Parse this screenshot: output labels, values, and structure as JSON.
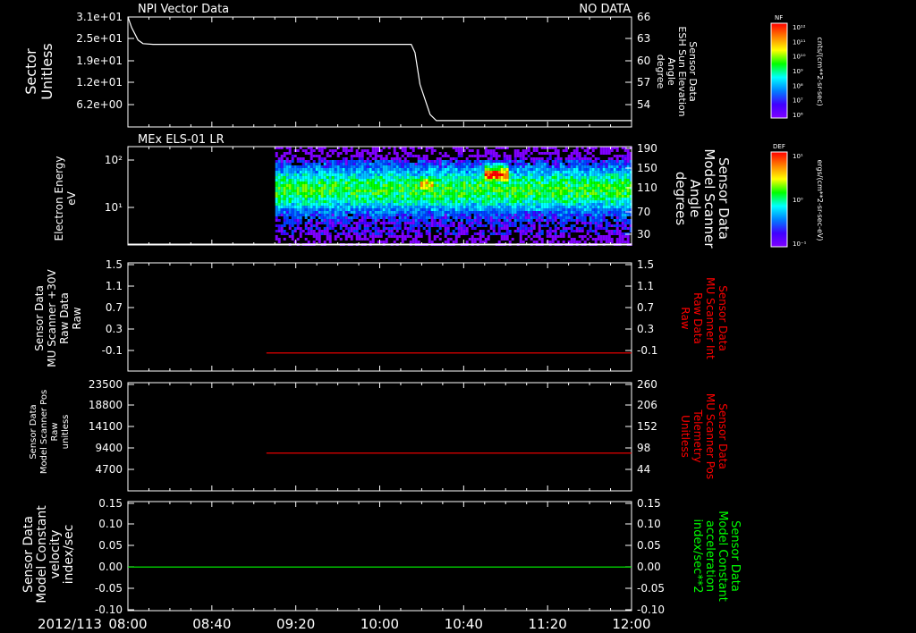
{
  "time_axis": {
    "date_label": "2012/113",
    "ticks": [
      "08:00",
      "08:40",
      "09:20",
      "10:00",
      "10:40",
      "11:20",
      "12:00"
    ],
    "range_hours": [
      8.0,
      12.0
    ]
  },
  "colorbars": [
    {
      "title": "NF",
      "units": "cnts/(cm**2-sr-sec)",
      "tick_labels": [
        "10¹²",
        "10¹¹",
        "10¹⁰",
        "10⁹",
        "10⁸",
        "10⁷",
        "10⁶"
      ],
      "palette": [
        "#ff0000",
        "#ff8000",
        "#ffff00",
        "#00ff00",
        "#00ffff",
        "#0080ff",
        "#4000ff",
        "#8000ff"
      ]
    },
    {
      "title": "DEF",
      "units": "ergs/(cm**2-sr-sec-eV)",
      "tick_labels": [
        "10¹",
        "10⁰",
        "10⁻¹"
      ],
      "palette": [
        "#ff0000",
        "#ff8000",
        "#ffff00",
        "#00ff00",
        "#00ffff",
        "#0080ff",
        "#4000ff",
        "#8000ff"
      ]
    }
  ],
  "panels": [
    {
      "id": "sector",
      "title_left": "NPI Vector Data",
      "title_right": "NO DATA",
      "ylabel_left": [
        "Sector",
        "Unitless"
      ],
      "ylabel_right": [
        "Sensor Data",
        "ESH Sun Elevation",
        "Angle",
        "degree"
      ],
      "ylabel_right_color": "#ffffff",
      "yticks_left": [
        "3.1e+01",
        "2.5e+01",
        "1.9e+01",
        "1.2e+01",
        "6.2e+00"
      ],
      "yticks_right": [
        "66",
        "63",
        "60",
        "57",
        "54"
      ],
      "line_color": "#ffffff"
    },
    {
      "id": "els",
      "title_left": "MEx ELS-01 LR",
      "ylabel_left": [
        "Electron Energy",
        "eV"
      ],
      "ylabel_right": [
        "Sensor Data",
        "Model Scanner",
        "Angle",
        "degrees"
      ],
      "ylabel_right_color": "#ffffff",
      "yticks_left_major": [
        "10²",
        "10¹"
      ],
      "yticks_right": [
        "190",
        "150",
        "110",
        "70",
        "30"
      ]
    },
    {
      "id": "mu_raw",
      "ylabel_left": [
        "Sensor Data",
        "MU Scanner +30V",
        "Raw Data",
        "Raw"
      ],
      "ylabel_right": [
        "Sensor Data",
        "MU Scanner Int",
        "Raw Data",
        "Raw"
      ],
      "ylabel_right_color": "#ff0000",
      "yticks_left": [
        "1.5",
        "1.1",
        "0.7",
        "0.3",
        "-0.1"
      ],
      "yticks_right": [
        "1.5",
        "1.1",
        "0.7",
        "0.3",
        "-0.1"
      ],
      "line_color": "#ff0000"
    },
    {
      "id": "mu_pos",
      "ylabel_left": [
        "Sensor Data",
        "Model Scanner Pos",
        "Raw",
        "unitless"
      ],
      "ylabel_right": [
        "Sensor Data",
        "MU Scanner Pos",
        "Telemetry",
        "Unitless"
      ],
      "ylabel_right_color": "#ff0000",
      "yticks_left": [
        "23500",
        "18800",
        "14100",
        "9400",
        "4700"
      ],
      "yticks_right": [
        "260",
        "206",
        "152",
        "98",
        "44"
      ],
      "line_color": "#ff0000"
    },
    {
      "id": "model_const",
      "ylabel_left": [
        "Sensor Data",
        "Model Constant",
        "velocity",
        "index/sec"
      ],
      "ylabel_right": [
        "Sensor Data",
        "Model Constant",
        "acceleration",
        "index/sec**2"
      ],
      "ylabel_right_color": "#00ff00",
      "yticks_left": [
        "0.15",
        "0.10",
        "0.05",
        "0.00",
        "-0.05",
        "-0.10"
      ],
      "yticks_right": [
        "0.15",
        "0.10",
        "0.05",
        "0.00",
        "-0.05",
        "-0.10"
      ],
      "line_color": "#00ff00"
    }
  ],
  "chart_data": [
    {
      "type": "line",
      "panel": "sector",
      "xlabel": "",
      "ylabel": "Sector Unitless",
      "x_unit": "hours UT",
      "ylim": [
        0,
        31
      ],
      "x": [
        8.0,
        8.03,
        8.08,
        8.12,
        8.2,
        9.0,
        9.8,
        10.0,
        10.25,
        10.28,
        10.32,
        10.4,
        10.45,
        11.0,
        12.0
      ],
      "values": [
        31,
        28,
        24.5,
        23.5,
        23.3,
        23.3,
        23.3,
        23.3,
        23.3,
        21,
        12,
        3.5,
        1.8,
        1.8,
        1.8
      ]
    },
    {
      "type": "heatmap",
      "panel": "els",
      "title": "MEx ELS-01 LR",
      "ylabel": "Electron Energy eV",
      "ylim_log10": [
        0.3,
        2.3
      ],
      "data_start_hour": 9.17,
      "features": [
        {
          "x_range": [
            9.17,
            12.0
          ],
          "log10_energy": 1.45,
          "intensity": 0.65
        },
        {
          "x_range": [
            10.3,
            10.42
          ],
          "log10_energy": 1.55,
          "intensity": 0.9
        },
        {
          "x_range": [
            10.83,
            11.02
          ],
          "log10_energy": 1.75,
          "intensity": 1.0
        }
      ]
    },
    {
      "type": "line",
      "panel": "mu_raw",
      "ylim": [
        -0.3,
        1.5
      ],
      "x": [
        9.1,
        12.0
      ],
      "values": [
        0.0,
        0.0
      ]
    },
    {
      "type": "line",
      "panel": "mu_pos",
      "ylim": [
        0,
        23500
      ],
      "x": [
        9.1,
        12.0
      ],
      "values": [
        8200,
        8200
      ]
    },
    {
      "type": "line",
      "panel": "model_const",
      "ylim": [
        -0.1,
        0.15
      ],
      "x": [
        8.0,
        12.0
      ],
      "values": [
        0.0,
        0.0
      ]
    }
  ]
}
